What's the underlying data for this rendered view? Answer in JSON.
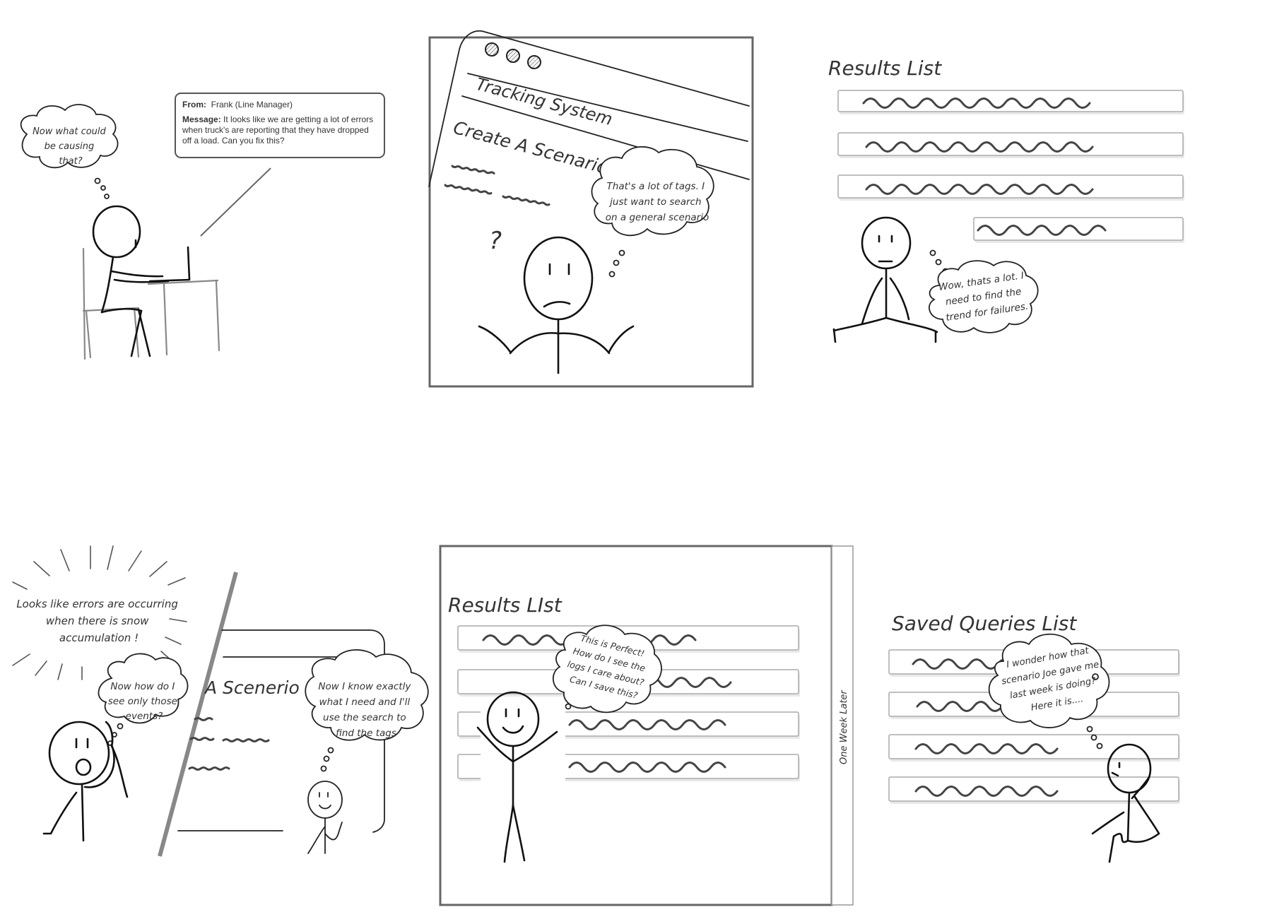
{
  "panel1": {
    "thought": [
      "Now what could",
      "be causing",
      "that?"
    ],
    "message": {
      "from_label": "From:",
      "from_value": "Frank (Line Manager)",
      "message_label": "Message:",
      "message_value": "It looks like we are getting a lot of errors when truck's are reporting that they have dropped off a load.  Can you fix this?"
    }
  },
  "panel2": {
    "app_title": "Tracking System",
    "screen_title": "Create A Scenario",
    "question_mark": "?",
    "thought": [
      "That's a lot of tags. I",
      "just want to search",
      "on a general scenario"
    ]
  },
  "panel3": {
    "title": "Results List",
    "thought": [
      "Wow, thats a lot. I",
      "need to find the",
      "trend for failures."
    ]
  },
  "panel4": {
    "shout": [
      "Looks like errors are occurring",
      "when there is snow",
      "accumulation !"
    ],
    "thought_left": [
      "Now how do I",
      "see only those",
      "events?"
    ],
    "screen_title": "A Scenerio",
    "thought_right": [
      "Now I know exactly",
      "what I need and I'll",
      "use the search to",
      "find the tags"
    ]
  },
  "panel5": {
    "title": "Results LIst",
    "thought": [
      "This is Perfect!",
      "How do I see the",
      "logs I care about?",
      "Can I save this?"
    ],
    "side_label": "One Week Later"
  },
  "panel6": {
    "title": "Saved Queries List",
    "thought": [
      "I wonder how that",
      "scenario Joe gave me",
      "last week is doing?",
      "Here it is...."
    ]
  }
}
